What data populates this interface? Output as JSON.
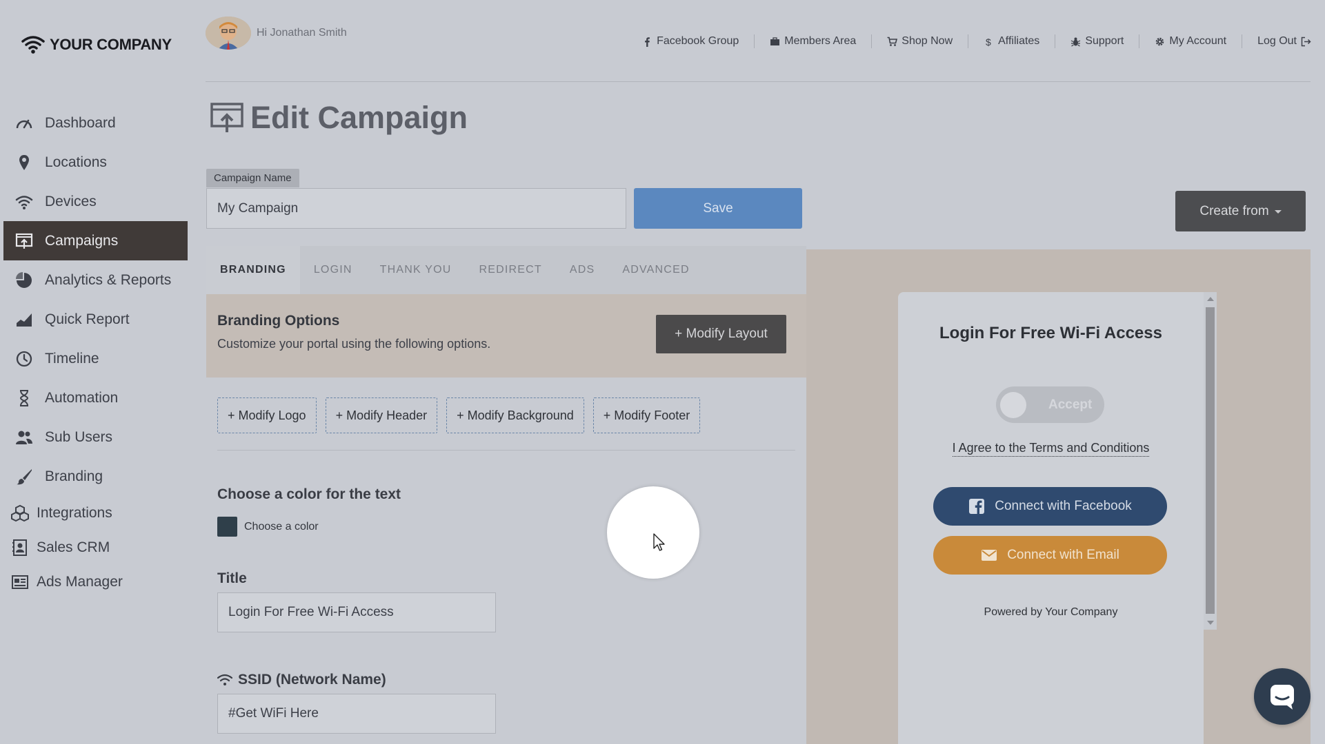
{
  "brand": {
    "logo_text": "YOUR COMPANY"
  },
  "header": {
    "greeting": "Hi Jonathan Smith",
    "nav": [
      {
        "label": "Facebook Group",
        "icon": "facebook-icon"
      },
      {
        "label": "Members Area",
        "icon": "briefcase-icon"
      },
      {
        "label": "Shop Now",
        "icon": "cart-icon"
      },
      {
        "label": "Affiliates",
        "icon": "dollar-icon"
      },
      {
        "label": "Support",
        "icon": "bug-icon"
      },
      {
        "label": "My Account",
        "icon": "gear-icon"
      },
      {
        "label": "Log Out",
        "icon": "logout-icon"
      }
    ]
  },
  "sidebar": {
    "items": [
      {
        "label": "Dashboard",
        "icon": "gauge-icon"
      },
      {
        "label": "Locations",
        "icon": "map-pin-icon"
      },
      {
        "label": "Devices",
        "icon": "wifi-icon"
      },
      {
        "label": "Campaigns",
        "icon": "campaign-icon",
        "active": true
      },
      {
        "label": "Analytics & Reports",
        "icon": "pie-chart-icon"
      },
      {
        "label": "Quick Report",
        "icon": "area-chart-icon"
      },
      {
        "label": "Timeline",
        "icon": "clock-icon"
      },
      {
        "label": "Automation",
        "icon": "hourglass-icon"
      },
      {
        "label": "Sub Users",
        "icon": "users-icon"
      },
      {
        "label": "Branding",
        "icon": "brush-icon"
      },
      {
        "label": "Integrations",
        "icon": "cubes-icon"
      },
      {
        "label": "Sales CRM",
        "icon": "contact-card-icon"
      },
      {
        "label": "Ads Manager",
        "icon": "newspaper-icon"
      }
    ]
  },
  "page": {
    "title": "Edit Campaign"
  },
  "campaign_form": {
    "label": "Campaign Name",
    "value": "My Campaign",
    "save_label": "Save",
    "create_from_label": "Create from"
  },
  "tabs": [
    "BRANDING",
    "LOGIN",
    "THANK YOU",
    "REDIRECT",
    "ADS",
    "ADVANCED"
  ],
  "branding": {
    "title": "Branding Options",
    "subtitle": "Customize your portal using the following options.",
    "modify_layout_label": "+ Modify Layout",
    "modify_buttons": [
      "+ Modify Logo",
      "+ Modify Header",
      "+ Modify Background",
      "+ Modify Footer"
    ],
    "color_section_title": "Choose a color for the text",
    "color_picker_label": "Choose a color",
    "text_color": "#2f3f4a",
    "title_label": "Title",
    "title_value": "Login For Free Wi-Fi Access",
    "ssid_label": "SSID (Network Name)",
    "ssid_value": "#Get WiFi Here"
  },
  "preview": {
    "title": "Login For Free Wi-Fi Access",
    "toggle_label": "Accept",
    "terms_text": "I Agree to the Terms and Conditions",
    "facebook_label": "Connect with Facebook",
    "email_label": "Connect with Email",
    "powered_by": "Powered by Your Company",
    "facebook_color": "#2f4a6f",
    "email_color": "#c98a3a"
  }
}
